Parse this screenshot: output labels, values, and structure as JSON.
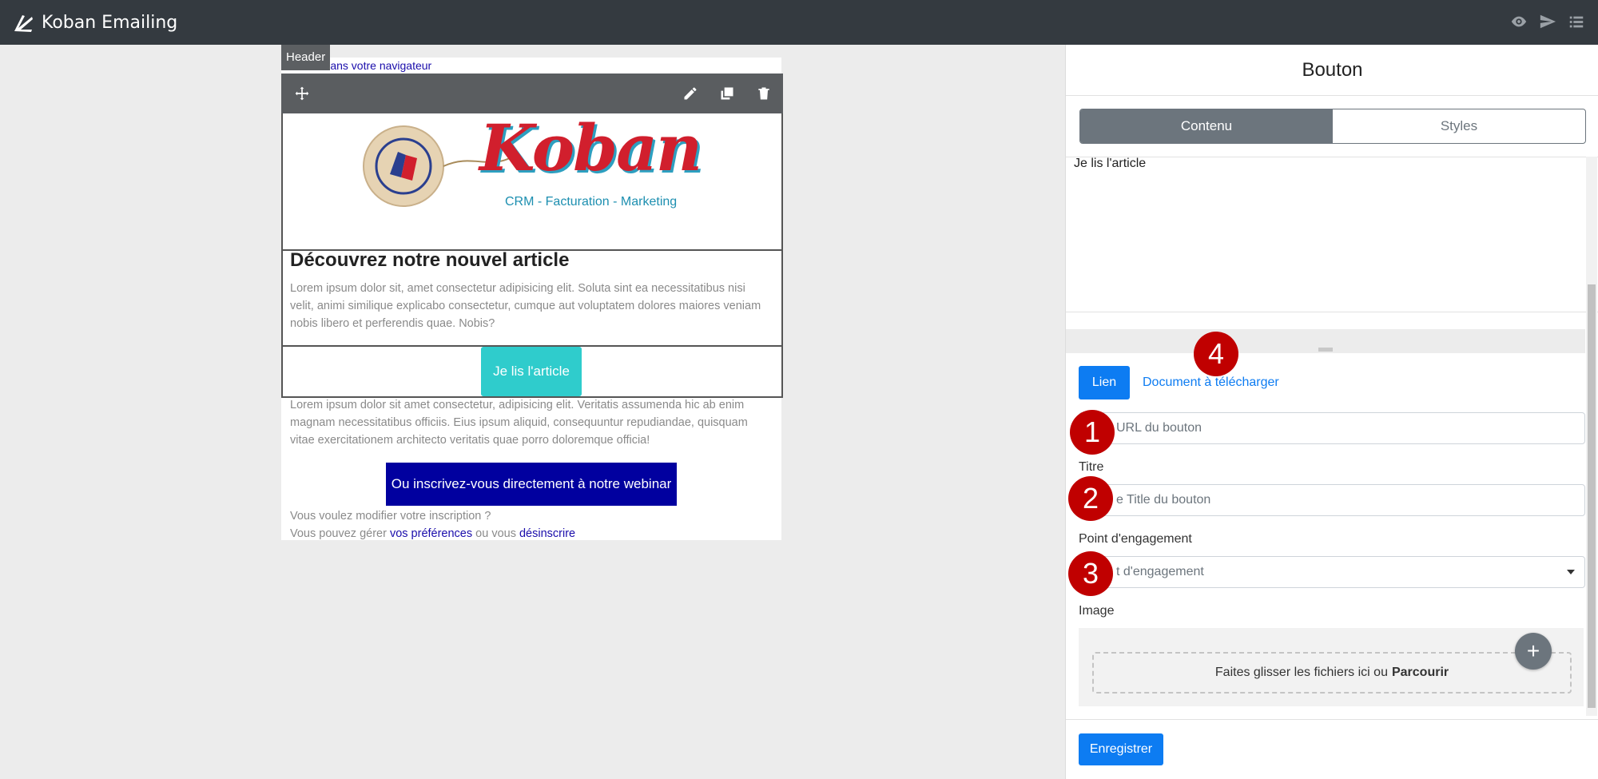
{
  "app": {
    "title": "Koban Emailing"
  },
  "topbar_icons": [
    "eye-icon",
    "send-icon",
    "list-icon"
  ],
  "email": {
    "header_tag": "Header",
    "view_in_browser": "r dans votre navigateur",
    "brand_word": "Koban",
    "brand_tagline": "CRM - Facturation - Marketing",
    "article_title": "Découvrez notre nouvel article",
    "article_text": "Lorem ipsum dolor sit, amet consectetur adipisicing elit. Soluta sint ea necessitatibus nisi velit, animi similique explicabo consectetur, cumque aut voluptatem dolores maiores veniam nobis libero et perferendis quae. Nobis?",
    "cta_article": "Je lis l'article",
    "article_text2": "Lorem ipsum dolor sit amet consectetur, adipisicing elit. Veritatis assumenda hic ab enim magnam necessitatibus officiis. Eius ipsum aliquid, consequuntur repudiandae, quisquam vitae exercitationem architecto veritatis quae porro doloremque officia!",
    "cta_webinar": "Ou inscrivez-vous directement à notre webinar",
    "footer_line1": "Vous voulez modifier votre inscription ?",
    "footer_prefix": "Vous pouvez gérer",
    "footer_link1": "vos préférences",
    "footer_mid": "ou vous",
    "footer_link2": "désinscrire"
  },
  "panel": {
    "title": "Bouton",
    "tabs": [
      {
        "label": "Contenu",
        "active": true
      },
      {
        "label": "Styles",
        "active": false
      }
    ],
    "editor_text": "Je lis l'article",
    "btn_lien": "Lien",
    "link_document": "Document à télécharger",
    "url_placeholder": "URL du bouton",
    "title_label": "Titre",
    "title_placeholder": "e Title du bouton",
    "engagement_label": "Point d'engagement",
    "engagement_value": "t d'engagement",
    "image_label": "Image",
    "dropzone_text": "Faites glisser les fichiers ici ou",
    "dropzone_browse": "Parcourir",
    "save_label": "Enregistrer"
  },
  "badges": [
    "1",
    "2",
    "3",
    "4"
  ],
  "colors": {
    "topbar": "#343a40",
    "accent_blue": "#0d7cf2",
    "cta_teal": "#2fcccc",
    "cta_navy": "#01009f",
    "badge_red": "#c00000"
  }
}
